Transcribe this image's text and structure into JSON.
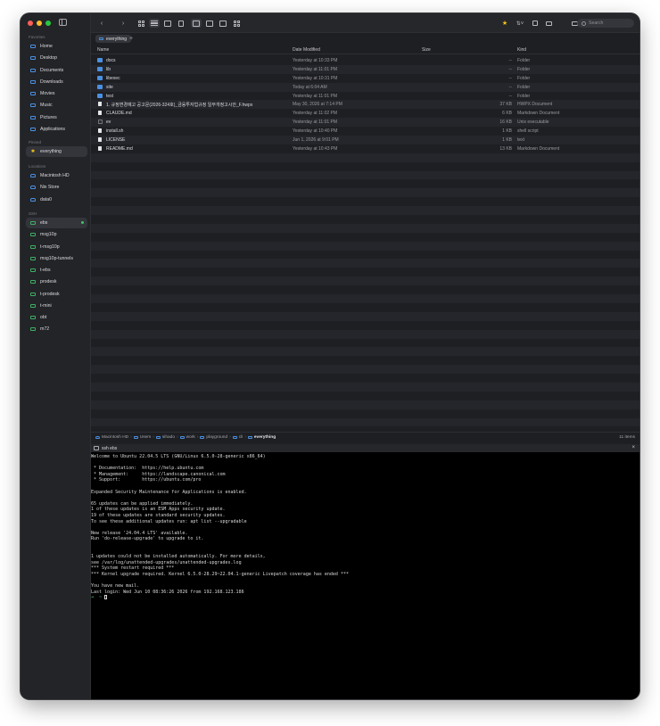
{
  "sidebar": {
    "favorites_label": "Favorites",
    "favorites": [
      "Home",
      "Desktop",
      "Documents",
      "Downloads",
      "Movies",
      "Music",
      "Pictures",
      "Applications"
    ],
    "pinned_label": "Pinned",
    "pinned": [
      "everything"
    ],
    "locations_label": "Locations",
    "locations": [
      "Macintosh HD",
      "Nix Store",
      "data0"
    ],
    "ssh_label": "SSH",
    "ssh": [
      "ebs",
      "msg10p",
      "t-msg10p",
      "msg10p-tunnels",
      "t-ebs",
      "prodesk",
      "t-prodesk",
      "t-mini",
      "obt",
      "m72"
    ]
  },
  "toolbar": {
    "search_placeholder": "Search",
    "icons": [
      "back-icon",
      "forward-icon",
      "icon-view-icon",
      "list-view-icon",
      "column-view-icon",
      "gallery-view-icon",
      "star-icon",
      "sort-icon",
      "copy-icon",
      "share-icon"
    ]
  },
  "tabs": {
    "active": "everything",
    "add": "+"
  },
  "columns": {
    "name": "Name",
    "date": "Date Modified",
    "size": "Size",
    "kind": "Kind"
  },
  "files": [
    {
      "name": "docs",
      "date": "Yesterday at 10:33 PM",
      "size": "--",
      "kind": "Folder",
      "icon": "folder"
    },
    {
      "name": "lib",
      "date": "Yesterday at 11:01 PM",
      "size": "--",
      "kind": "Folder",
      "icon": "folder"
    },
    {
      "name": "libexec",
      "date": "Yesterday at 10:31 PM",
      "size": "--",
      "kind": "Folder",
      "icon": "folder"
    },
    {
      "name": "site",
      "date": "Today at 6:04 AM",
      "size": "--",
      "kind": "Folder",
      "icon": "folder"
    },
    {
      "name": "test",
      "date": "Yesterday at 11:01 PM",
      "size": "--",
      "kind": "Folder",
      "icon": "folder"
    },
    {
      "name": "1. 규정변경예고 공고문(2026-324호)_금융투자업규정 일부개정고시안_F.hwpx",
      "date": "May 30, 2026 at 7:14 PM",
      "size": "37 KB",
      "kind": "HWPX Document",
      "icon": "doc"
    },
    {
      "name": "CLAUDE.md",
      "date": "Yesterday at 11:02 PM",
      "size": "6 KB",
      "kind": "Markdown Document",
      "icon": "doc"
    },
    {
      "name": "ev",
      "date": "Yesterday at 11:01 PM",
      "size": "16 KB",
      "kind": "Unix executable",
      "icon": "exec"
    },
    {
      "name": "install.sh",
      "date": "Yesterday at 10:40 PM",
      "size": "1 KB",
      "kind": "shell script",
      "icon": "doc"
    },
    {
      "name": "LICENSE",
      "date": "Jun 1, 2026 at 9:01 PM",
      "size": "1 KB",
      "kind": "text",
      "icon": "doc"
    },
    {
      "name": "README.md",
      "date": "Yesterday at 10:43 PM",
      "size": "13 KB",
      "kind": "Markdown Document",
      "icon": "doc"
    }
  ],
  "pathbar": {
    "crumbs": [
      "Macintosh HD",
      "Users",
      "sihado",
      "work",
      "playground",
      "cli",
      "everything"
    ],
    "count": "11 items"
  },
  "terminal": {
    "title": "ssh ebs",
    "close": "×",
    "lines": [
      "Welcome to Ubuntu 22.04.5 LTS (GNU/Linux 6.5.0-28-generic x86_64)",
      "",
      " * Documentation:  https://help.ubuntu.com",
      " * Management:     https://landscape.canonical.com",
      " * Support:        https://ubuntu.com/pro",
      "",
      "Expanded Security Maintenance for Applications is enabled.",
      "",
      "65 updates can be applied immediately.",
      "1 of these updates is an ESM Apps security update.",
      "19 of these updates are standard security updates.",
      "To see these additional updates run: apt list --upgradable",
      "",
      "New release '24.04.4 LTS' available.",
      "Run 'do-release-upgrade' to upgrade to it.",
      "",
      "",
      "1 updates could not be installed automatically. For more details,",
      "see /var/log/unattended-upgrades/unattended-upgrades.log",
      "*** System restart required ***",
      "*** Kernel upgrade required. Kernel 6.5.0-28.29~22.04.1-generic Livepatch coverage has ended ***",
      "",
      "You have new mail.",
      "Last login: Wed Jun 10 08:36:26 2026 from 192.168.123.186"
    ],
    "prompt": "➜  ~ "
  },
  "colors": {
    "accent": "#4a90e2",
    "status_green": "#3fc46a",
    "star": "#f5c518"
  }
}
